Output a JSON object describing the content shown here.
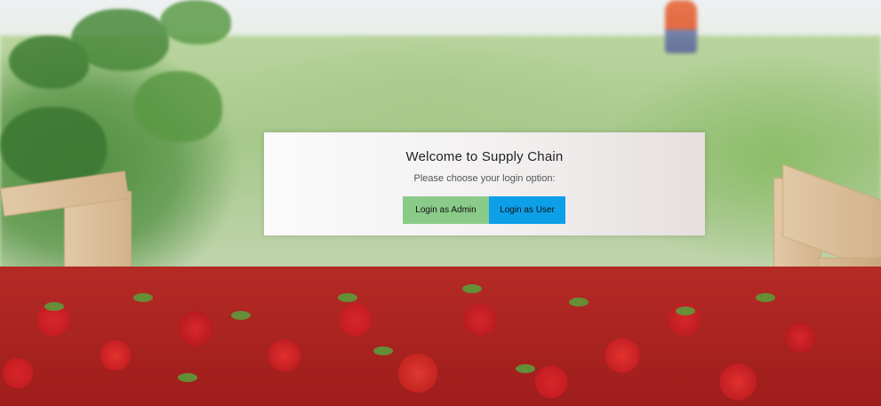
{
  "login": {
    "title": "Welcome to Supply Chain",
    "subtitle": "Please choose your login option:",
    "admin_button_label": "Login as Admin",
    "user_button_label": "Login as User"
  },
  "colors": {
    "admin_button": "#8acb8a",
    "user_button": "#0da0e8",
    "card_background": "#f5f3f3"
  },
  "background": {
    "image_subject": "strawberries-in-wooden-crate"
  }
}
